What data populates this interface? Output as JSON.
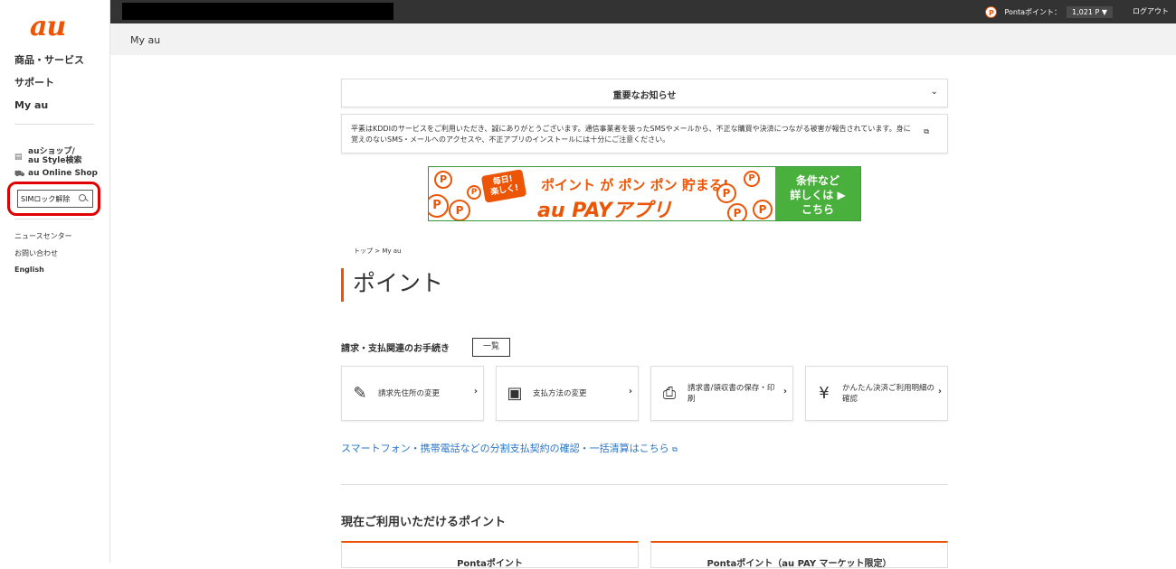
{
  "sidebar": {
    "logo": "au",
    "nav_main": [
      "商品・サービス",
      "サポート",
      "My au"
    ],
    "shop_search": "auショップ/\nau Style検索",
    "online_shop": "au Online Shop",
    "search_value": "SIMロック解除",
    "nav_sub": [
      "ニュースセンター",
      "お問い合わせ",
      "English"
    ]
  },
  "topbar": {
    "ponta_label": "Pontaポイント：",
    "ponta_points": "1,021 P ▼",
    "logout": "ログアウト"
  },
  "titlebar": {
    "title": "My au"
  },
  "notice": {
    "title": "重要なお知らせ",
    "body": "平素はKDDIのサービスをご利用いただき、誠にありがとうございます。通信事業者を装ったSMSやメールから、不正な購買や決済につながる被害が報告されています。身に覚えのないSMS・メールへのアクセスや、不正アプリのインストールには十分にご注意ください。"
  },
  "banner": {
    "tag": "毎日!\n楽しく!",
    "line1": "ポイント が ポン ポン 貯まる!",
    "line2": "au PAYアプリ",
    "cta": "条件など\n詳しくは ▶\nこちら"
  },
  "breadcrumb": "トップ > My au",
  "page_title": "ポイント",
  "billing": {
    "title": "請求・支払関連のお手続き",
    "list_button": "一覧",
    "cards": [
      {
        "icon": "pen-icon",
        "label": "請求先住所の変更"
      },
      {
        "icon": "wallet-icon",
        "label": "支払方法の変更"
      },
      {
        "icon": "printer-icon",
        "label": "請求書/領収書の保存・印刷"
      },
      {
        "icon": "phone-yen-icon",
        "label": "かんたん決済ご利用明細の確認"
      }
    ]
  },
  "installment_link": "スマートフォン・携帯電話などの分割支払契約の確認・一括清算はこちら",
  "points": {
    "title": "現在ご利用いただけるポイント",
    "cards": [
      "Pontaポイント",
      "Pontaポイント（au PAY マーケット限定）"
    ]
  }
}
